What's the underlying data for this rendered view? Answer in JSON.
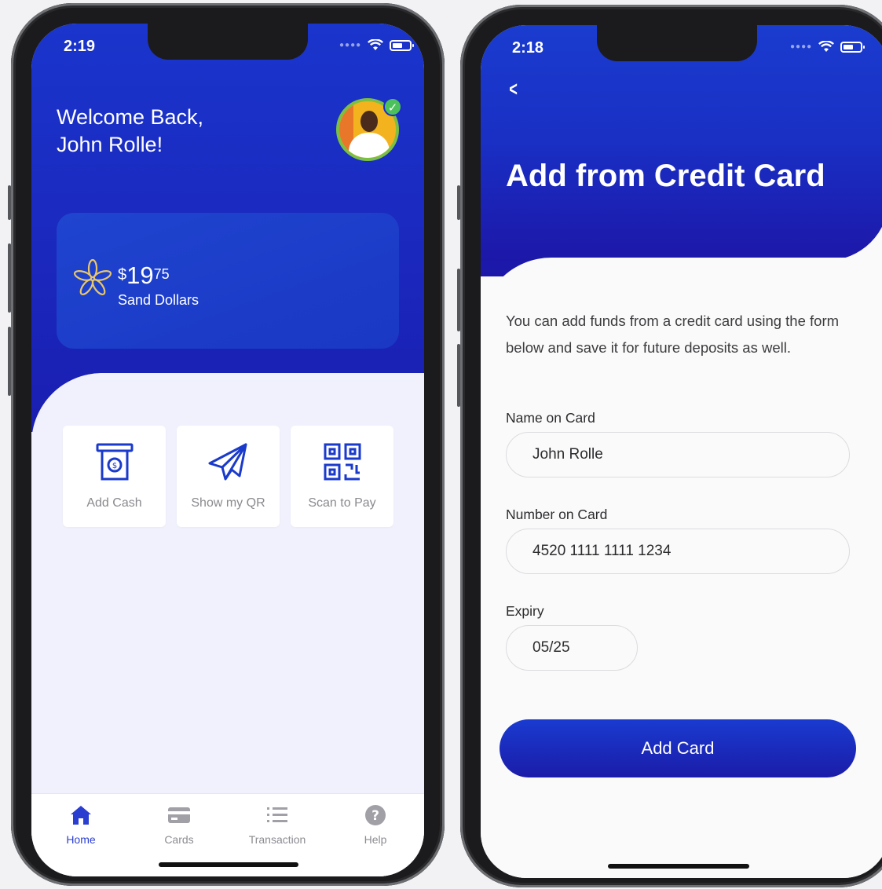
{
  "left_phone": {
    "status": {
      "time": "2:19",
      "signal_icon": "signal-dots-icon",
      "wifi_icon": "wifi-icon",
      "battery_icon": "battery-icon"
    },
    "welcome": {
      "line1": "Welcome Back,",
      "line2": "John Rolle!"
    },
    "profile": {
      "avatar_icon": "avatar",
      "verified_icon": "verified-check-icon"
    },
    "balance": {
      "currency_symbol": "$",
      "whole": "19",
      "cents": "75",
      "currency_name": "Sand Dollars",
      "icon": "sand-dollar-flower-icon"
    },
    "actions": [
      {
        "label": "Add Cash",
        "icon": "atm-cash-icon"
      },
      {
        "label": "Show my QR",
        "icon": "paper-plane-icon"
      },
      {
        "label": "Scan to Pay",
        "icon": "qr-scan-icon"
      }
    ],
    "tabs": [
      {
        "label": "Home",
        "icon": "home-icon",
        "active": true
      },
      {
        "label": "Cards",
        "icon": "card-icon",
        "active": false
      },
      {
        "label": "Transaction",
        "icon": "list-icon",
        "active": false
      },
      {
        "label": "Help",
        "icon": "help-icon",
        "active": false
      }
    ]
  },
  "right_phone": {
    "status": {
      "time": "2:18",
      "signal_icon": "signal-dots-icon",
      "wifi_icon": "wifi-icon",
      "battery_icon": "battery-icon"
    },
    "back_icon": "chevron-left-icon",
    "title": "Add from Credit Card",
    "intro": "You can add funds from a credit card using the form below and save it for future deposits as well.",
    "form": {
      "name_label": "Name on Card",
      "name_value": "John Rolle",
      "number_label": "Number on Card",
      "number_value": "4520 1111 1111 1234",
      "expiry_label": "Expiry",
      "expiry_value": "05/25"
    },
    "submit_label": "Add Card"
  },
  "colors": {
    "brand_blue": "#1a35cc",
    "brand_blue_dark": "#1c17a8",
    "gold": "#e8c66a",
    "active_tab": "#2a3fd0",
    "verified_green": "#4cc05a"
  }
}
